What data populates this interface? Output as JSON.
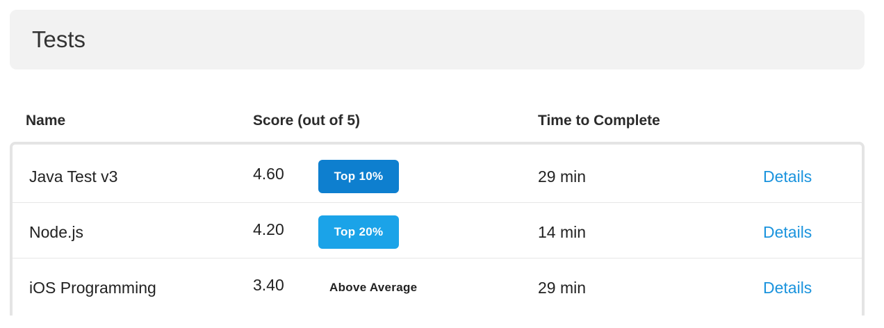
{
  "header": {
    "title": "Tests"
  },
  "table": {
    "columns": {
      "name": "Name",
      "score": "Score (out of 5)",
      "time": "Time to Complete"
    },
    "rows": [
      {
        "name": "Java Test v3",
        "score": "4.60",
        "badge": "Top 10%",
        "badge_color": "#0e7fcf",
        "badge_style": "filled",
        "time": "29 min",
        "link": "Details"
      },
      {
        "name": "Node.js",
        "score": "4.20",
        "badge": "Top 20%",
        "badge_color": "#1ba3e8",
        "badge_style": "filled",
        "time": "14 min",
        "link": "Details"
      },
      {
        "name": "iOS Programming",
        "score": "3.40",
        "badge": "Above Average",
        "badge_color": "",
        "badge_style": "plain",
        "time": "29 min",
        "link": "Details"
      }
    ]
  },
  "colors": {
    "link": "#1a93dd",
    "header_bg": "#f2f2f2",
    "frame_border": "#e4e4e4"
  }
}
